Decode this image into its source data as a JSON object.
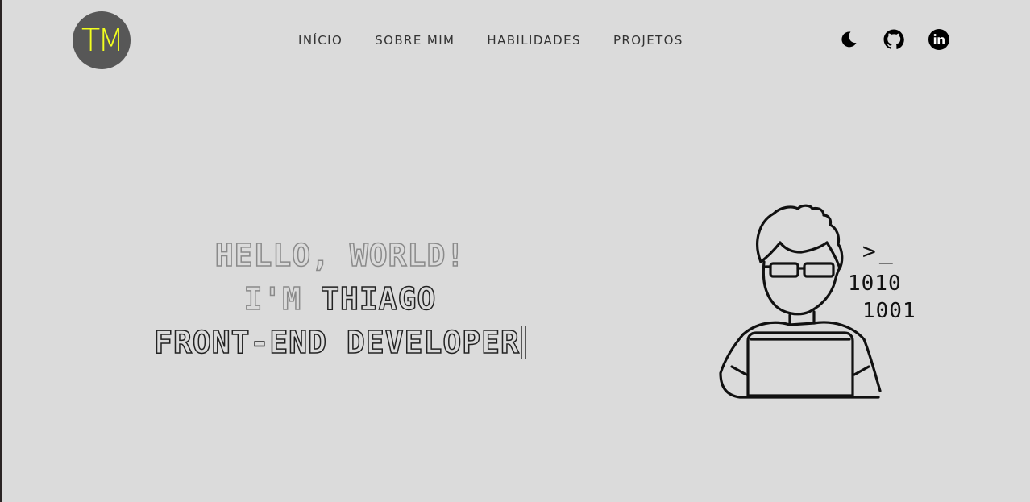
{
  "header": {
    "logo_text": "TM",
    "nav": [
      {
        "label": "INÍCIO"
      },
      {
        "label": "SOBRE MIM"
      },
      {
        "label": "HABILIDADES"
      },
      {
        "label": "PROJETOS"
      }
    ],
    "icons": [
      "moon-icon",
      "github-icon",
      "linkedin-icon"
    ]
  },
  "hero": {
    "line1": "HELLO, WORLD!",
    "line2_prefix": "I'M ",
    "line2_name": "THIAGO",
    "line3": "FRONT-END DEVELOPER"
  },
  "illustration": {
    "prompt": ">_",
    "binary1": "1010",
    "binary2": "1001"
  },
  "colors": {
    "background": "#dbdbdb",
    "logo_bg": "#575757",
    "logo_text": "#f2ff1f",
    "text": "#333333"
  }
}
